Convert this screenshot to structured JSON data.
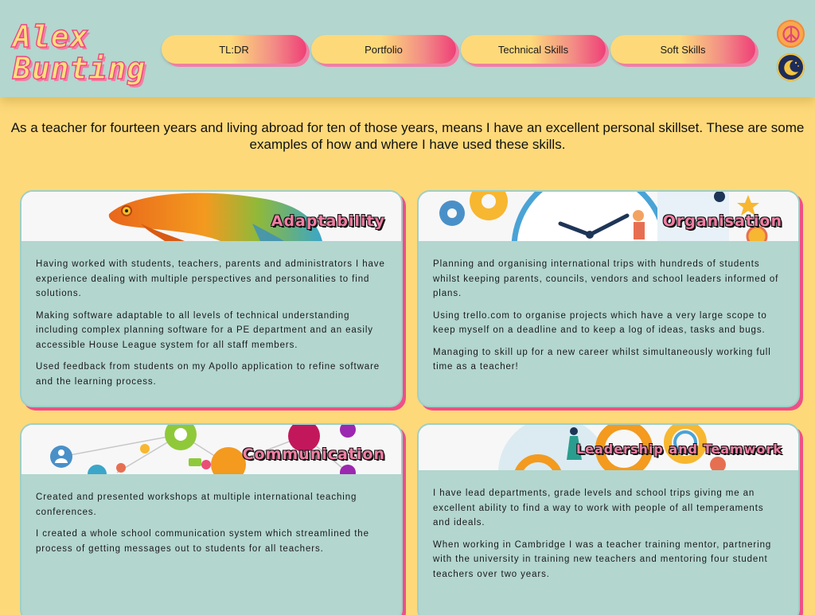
{
  "header": {
    "logo_line1": "Alex",
    "logo_line2": "Bunting",
    "nav": [
      "TL:DR",
      "Portfolio",
      "Technical Skills",
      "Soft Skills"
    ]
  },
  "intro": "As a teacher for fourteen years and living abroad for ten of those years, means I have an excellent personal skillset. These are some examples of how and where I have used these skills.",
  "cards": [
    {
      "title": "Adaptability",
      "paragraphs": [
        "Having worked with students, teachers, parents and administrators I have experience dealing with multiple perspectives and personalities to find solutions.",
        "Making software adaptable to all levels of technical understanding including complex planning software for a PE department and an easily accessible House League system for all staff members.",
        "Used feedback from students on my Apollo application to refine software and the learning process."
      ]
    },
    {
      "title": "Organisation",
      "paragraphs": [
        "Planning and organising international trips with hundreds of students whilst keeping parents, councils, vendors and school leaders informed of plans.",
        "Using trello.com to organise projects which have a very large scope to keep myself on a deadline and to keep a log of ideas, tasks and bugs.",
        "Managing to skill up for a new career whilst simultaneously working full time as a teacher!"
      ]
    },
    {
      "title": "Communication",
      "paragraphs": [
        "Created and presented workshops at multiple international teaching conferences.",
        "I created a whole school communication system which streamlined the process of getting messages out to students for all teachers."
      ]
    },
    {
      "title": "Leadership and Teamwork",
      "paragraphs": [
        "I have lead departments, grade levels and school trips giving me an excellent ability to find a way to work with people of all temperaments and ideals.",
        "When working in Cambridge I was a teacher training mentor, partnering with the university in training new teachers and mentoring four student teachers over two years."
      ]
    }
  ],
  "colors": {
    "header_bg": "#b3d6cf",
    "page_bg": "#fdd97a",
    "accent_pink": "#ef4f86",
    "card_bg": "#b3d6cf"
  },
  "icons": [
    "peace-icon",
    "moon-icon"
  ]
}
